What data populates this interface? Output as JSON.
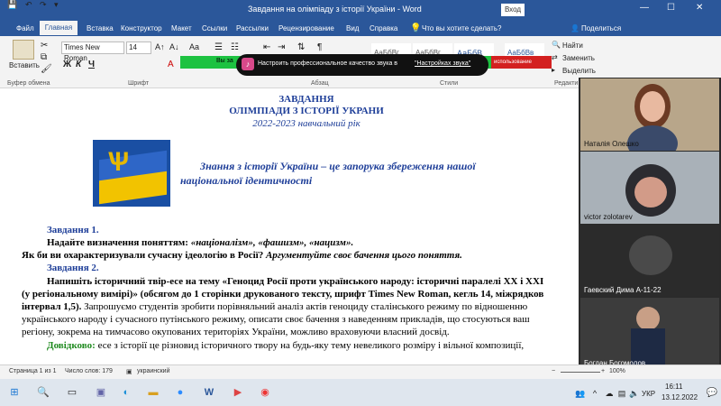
{
  "window": {
    "title": "Завдання на олімпіаду з історії України  -  Word",
    "signin": "Вход",
    "min_glyph": "—",
    "max_glyph": "☐",
    "close_glyph": "✕"
  },
  "quick_access": {
    "save_glyph": "💾",
    "undo_glyph": "↶",
    "redo_glyph": "↷",
    "more_glyph": "▾"
  },
  "tabs": [
    "Файл",
    "Главная",
    "Вставка",
    "Конструктор",
    "Макет",
    "Ссылки",
    "Рассылки",
    "Рецензирование",
    "Вид",
    "Справка"
  ],
  "tell_me": "Что вы хотите сделать?",
  "share": "Поделиться",
  "ribbon": {
    "paste": "Вставить",
    "clipboard_label": "Буфер обмена",
    "font_name": "Times New Roman",
    "font_size": "14",
    "font_label": "Шрифт",
    "paragraph_label": "Абзац",
    "styles_label": "Стили",
    "edit_label": "Редакти",
    "find": "Найти",
    "replace": "Заменить",
    "select": "Выделить",
    "styles": [
      "АаБбВг",
      "АаБбВг",
      "АаБбВ",
      "АаБбВв"
    ],
    "bold": "Ж",
    "italic": "К",
    "underline": "Ч"
  },
  "overlay": {
    "left_text": "Вы за",
    "audio_text": "Настроить профессиональное качество звука в",
    "audio_link": "\"Настройках звука\"",
    "red_text": "использование"
  },
  "document": {
    "h1": "ЗАВДАННЯ",
    "h2": "ОЛІМПІАДИ З ІСТОРІЇ УКРАНИ",
    "h3": "2022-2023 навчальний рік",
    "quote_line1": "Знання з історії України – це запорука збереження нашої",
    "quote_line2": "національної ідентичності",
    "task1_title": "Завдання 1.",
    "task1_line1_lead": "Надайте визначення поняттям: ",
    "task1_line1_terms": "«націоналізм», «фашизм», «нацизм».",
    "task1_line2_q": "Як би ви охарактеризували сучасну ідеологію в Росії? ",
    "task1_line2_arg": "Аргументуйте своє бачення цього поняття.",
    "task2_title": "Завдання 2.",
    "task2_line1": "Напишіть історичний твір-есе на тему «Геноцид Росії проти українського народу: історичні паралелі XX і XXI",
    "task2_line2": "(у регіональному вимірі)» (обсягом до 1 сторінки друкованого тексту, шрифт Times New Roman, кегль 14, міжрядков",
    "task2_line3_bold": "інтервал 1,5). ",
    "task2_line3_rest": "Запрошуємо студентів зробити порівняльний аналіз актів геноциду сталінського режиму по відношенню",
    "task2_line4": "українського народу і сучасного путінського режиму, описати своє бачення з наведенням прикладів, що стосуються ваш",
    "task2_line5": "регіону, зокрема на тимчасово окупованих територіях України, можливо враховуючи власний досвід.",
    "note_label": "Довідково:",
    "note_text": " есе з історії це різновид історичного твору на будь-яку тему невеликого розміру і вільної композиції,"
  },
  "video": {
    "p1": "Наталія Олешко",
    "p2": "victor zolotarev",
    "p3": "Гаевский Дима А-11-22",
    "p4": "Богдан Богомолов"
  },
  "status": {
    "page": "Страница 1 из 1",
    "words": "Число слов: 179",
    "lang": "украинский",
    "zoom": "100%"
  },
  "taskbar": {
    "time": "16:11",
    "date": "13.12.2022",
    "lang": "УКР"
  }
}
